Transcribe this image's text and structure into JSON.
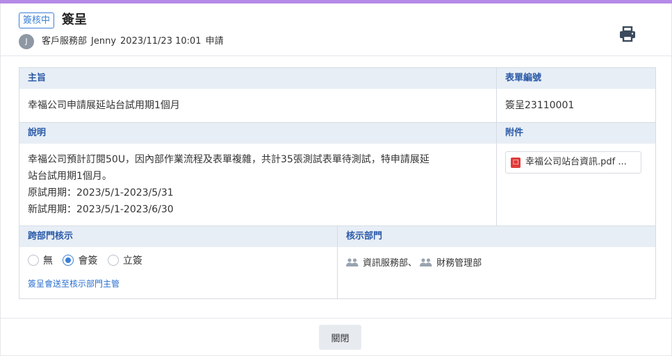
{
  "colors": {
    "accent": "#b48ae6",
    "primary": "#3a7fd6",
    "header_fill": "#e8eef6",
    "pdf_red": "#e03b3b"
  },
  "header": {
    "status_badge": "簽核中",
    "title": "簽呈",
    "avatar_initial": "J",
    "applicant_dept": "客戶服務部",
    "applicant_name": "Jenny",
    "datetime": "2023/11/23 10:01",
    "action": "申請",
    "print_icon": "printer-icon"
  },
  "form": {
    "subject": {
      "label": "主旨",
      "value": "幸福公司申請展延站台試用期1個月"
    },
    "form_number": {
      "label": "表單編號",
      "value": "簽呈23110001"
    },
    "description": {
      "label": "說明",
      "lines": [
        "幸福公司預計訂閱50U，因內部作業流程及表單複雜，共計35張測試表單待測試，特申請展延",
        "站台試用期1個月。",
        "原試用期：2023/5/1-2023/5/31",
        "新試用期：2023/5/1-2023/6/30"
      ]
    },
    "attachment": {
      "label": "附件",
      "file_name": "幸福公司站台資訊.pdf ...",
      "icon": "pdf-icon"
    },
    "cross_dept": {
      "label": "跨部門核示",
      "options": [
        {
          "label": "無",
          "checked": false
        },
        {
          "label": "會簽",
          "checked": true
        },
        {
          "label": "立簽",
          "checked": false
        }
      ],
      "hint": "簽呈會送至核示部門主管"
    },
    "approval_depts": {
      "label": "核示部門",
      "depts": [
        "資訊服務部",
        "財務管理部"
      ],
      "separator": "、",
      "icon": "people-icon"
    }
  },
  "footer": {
    "close_label": "關閉"
  }
}
